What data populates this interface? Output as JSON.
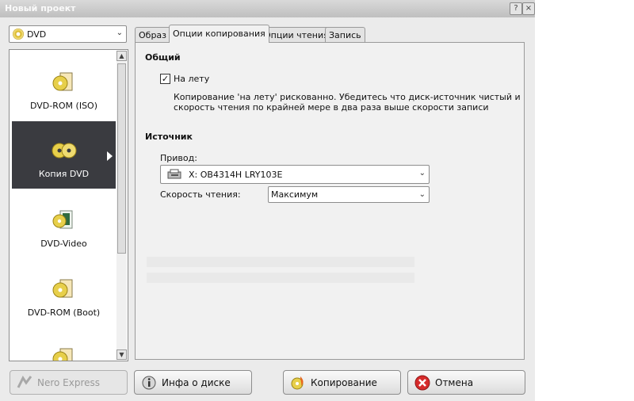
{
  "window": {
    "title": "Новый проект",
    "help_button": "?",
    "close_button": "×"
  },
  "project_type": {
    "selected": "DVD"
  },
  "left_list": {
    "items": [
      {
        "label": "DVD-ROM (ISO)",
        "icon": "dvd-rom-iso-icon",
        "selected": false
      },
      {
        "label": "Копия DVD",
        "icon": "dvd-copy-icon",
        "selected": true
      },
      {
        "label": "DVD-Video",
        "icon": "dvd-video-icon",
        "selected": false
      },
      {
        "label": "DVD-ROM (Boot)",
        "icon": "dvd-rom-boot-icon",
        "selected": false
      }
    ]
  },
  "tabs": [
    {
      "label": "Образ",
      "active": false
    },
    {
      "label": "Опции копирования",
      "active": true
    },
    {
      "label": "Опции чтения",
      "active": false
    },
    {
      "label": "Запись",
      "active": false
    }
  ],
  "general": {
    "heading": "Общий",
    "on_the_fly_label": "На лету",
    "on_the_fly_checked": true,
    "note_line1": "Копирование 'на лету' рискованно. Убедитесь что диск-источник чистый и",
    "note_line2": "скорость чтения по крайней мере в два раза выше скорости записи"
  },
  "source": {
    "heading": "Источник",
    "drive_label": "Привод:",
    "drive_value": "X: OB4314H LRY103E",
    "read_speed_label": "Скорость чтения:",
    "read_speed_value": "Максимум"
  },
  "buttons": {
    "nero_express": "Nero Express",
    "disc_info": "Инфа о диске",
    "copy": "Копирование",
    "cancel": "Отмена"
  },
  "colors": {
    "selected_item_bg": "#3a3b40",
    "panel_bg": "#f1f1f1",
    "window_bg": "#ebebeb",
    "cancel_red": "#d62b2b"
  }
}
